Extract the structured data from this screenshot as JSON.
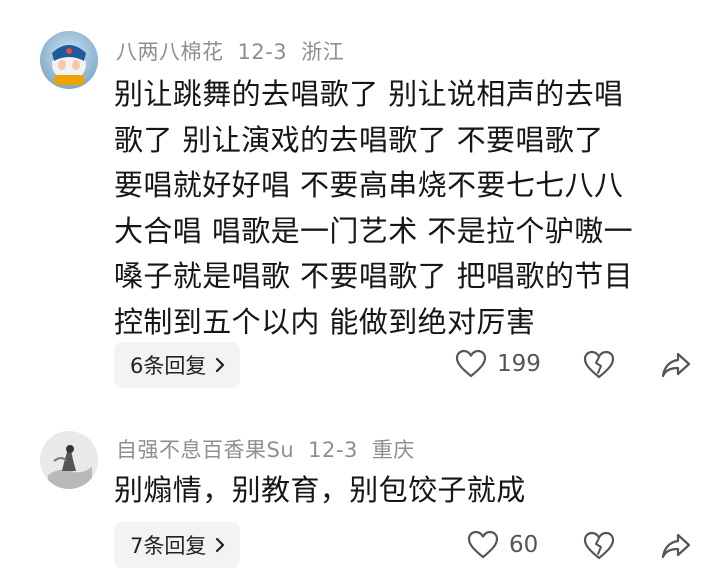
{
  "comments": [
    {
      "username": "八两八棉花",
      "date": "12-3",
      "location": "浙江",
      "lines": [
        "别让跳舞的去唱歌了 别让说相声的去唱",
        "歌了 别让演戏的去唱歌了 不要唱歌了",
        "要唱就好好唱 不要高串烧不要七七八八",
        "大合唱 唱歌是一门艺术 不是拉个驴嗷一",
        "嗓子就是唱歌 不要唱歌了 把唱歌的节目",
        "控制到五个以内 能做到绝对厉害"
      ],
      "replies_label": "6条回复",
      "likes": "199",
      "avatar_icon": "avatar-cartoon-icon"
    },
    {
      "username": "自强不息百香果Su",
      "date": "12-3",
      "location": "重庆",
      "lines": [
        "别煽情，别教育，别包饺子就成"
      ],
      "replies_label": "7条回复",
      "likes": "60",
      "avatar_icon": "avatar-ink-painting-icon"
    }
  ],
  "icons": {
    "like": "heart-outline-icon",
    "dislike": "heart-broken-icon",
    "share": "share-arrow-icon",
    "replies_arrow": "chevron-right-icon"
  },
  "colors": {
    "meta_text": "#8f8f8f",
    "body_text": "#161616",
    "reply_pill_bg": "#f3f3f3",
    "icon": "#555555"
  }
}
